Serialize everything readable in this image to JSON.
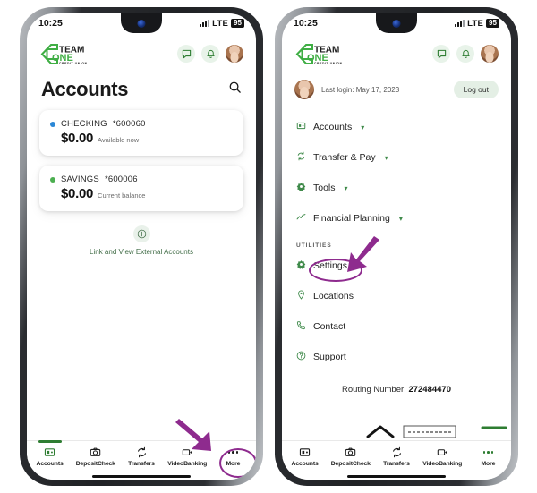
{
  "status_bar": {
    "time": "10:25",
    "network": "LTE",
    "battery": "95"
  },
  "brand": {
    "name_line1": "TEAM",
    "name_line2": "ONE",
    "tagline": "CREDIT UNION",
    "green": "#3fae44"
  },
  "colors": {
    "accent_green": "#2e7d32",
    "annotation_purple": "#8e2b8e",
    "checking_dot": "#2b87d6",
    "savings_dot": "#4caf50"
  },
  "phone_left": {
    "header_icons": [
      {
        "name": "messages-icon"
      },
      {
        "name": "notifications-icon"
      },
      {
        "name": "profile-avatar"
      }
    ],
    "page_title": "Accounts",
    "search_label": "Search",
    "accounts": [
      {
        "label": "CHECKING",
        "number": "*600060",
        "amount": "$0.00",
        "amount_sub": "Available now",
        "dot": "#2b87d6"
      },
      {
        "label": "SAVINGS",
        "number": "*600006",
        "amount": "$0.00",
        "amount_sub": "Current balance",
        "dot": "#4caf50"
      }
    ],
    "link_external": {
      "label": "Link and View External Accounts",
      "icon": "plus-circle-icon"
    },
    "nav": [
      {
        "label": "Accounts",
        "icon": "accounts-icon",
        "active": true
      },
      {
        "label": "DepositCheck",
        "icon": "camera-icon",
        "active": false
      },
      {
        "label": "Transfers",
        "icon": "transfers-icon",
        "active": false
      },
      {
        "label": "VideoBanking",
        "icon": "video-icon",
        "active": false
      },
      {
        "label": "More",
        "icon": "more-dots-icon",
        "active": false
      }
    ]
  },
  "phone_right": {
    "last_login": "Last login: May 17, 2023",
    "logout_label": "Log out",
    "menu_items": [
      {
        "label": "Accounts",
        "icon": "accounts-icon",
        "expandable": true
      },
      {
        "label": "Transfer & Pay",
        "icon": "transfers-icon",
        "expandable": true
      },
      {
        "label": "Tools",
        "icon": "tools-icon",
        "expandable": true
      },
      {
        "label": "Financial Planning",
        "icon": "chart-line-icon",
        "expandable": true
      }
    ],
    "utilities_header": "UTILITIES",
    "utilities": [
      {
        "label": "Settings",
        "icon": "gear-icon",
        "highlighted": true
      },
      {
        "label": "Locations",
        "icon": "map-pin-icon",
        "highlighted": false
      },
      {
        "label": "Contact",
        "icon": "phone-icon",
        "highlighted": false
      },
      {
        "label": "Support",
        "icon": "help-circle-icon",
        "highlighted": false
      }
    ],
    "routing_label": "Routing Number:",
    "routing_number": "272484470",
    "nav": [
      {
        "label": "Accounts",
        "icon": "accounts-icon",
        "active": false
      },
      {
        "label": "DepositCheck",
        "icon": "camera-icon",
        "active": false
      },
      {
        "label": "Transfers",
        "icon": "transfers-icon",
        "active": false
      },
      {
        "label": "VideoBanking",
        "icon": "video-icon",
        "active": false
      },
      {
        "label": "More",
        "icon": "more-dots-icon",
        "active": true
      }
    ]
  },
  "annotations": [
    {
      "name": "arrow-to-more-button",
      "target": "More"
    },
    {
      "name": "arrow-to-settings",
      "target": "Settings"
    },
    {
      "name": "ellipse-more-button",
      "target": "More"
    },
    {
      "name": "ellipse-settings",
      "target": "Settings"
    }
  ]
}
